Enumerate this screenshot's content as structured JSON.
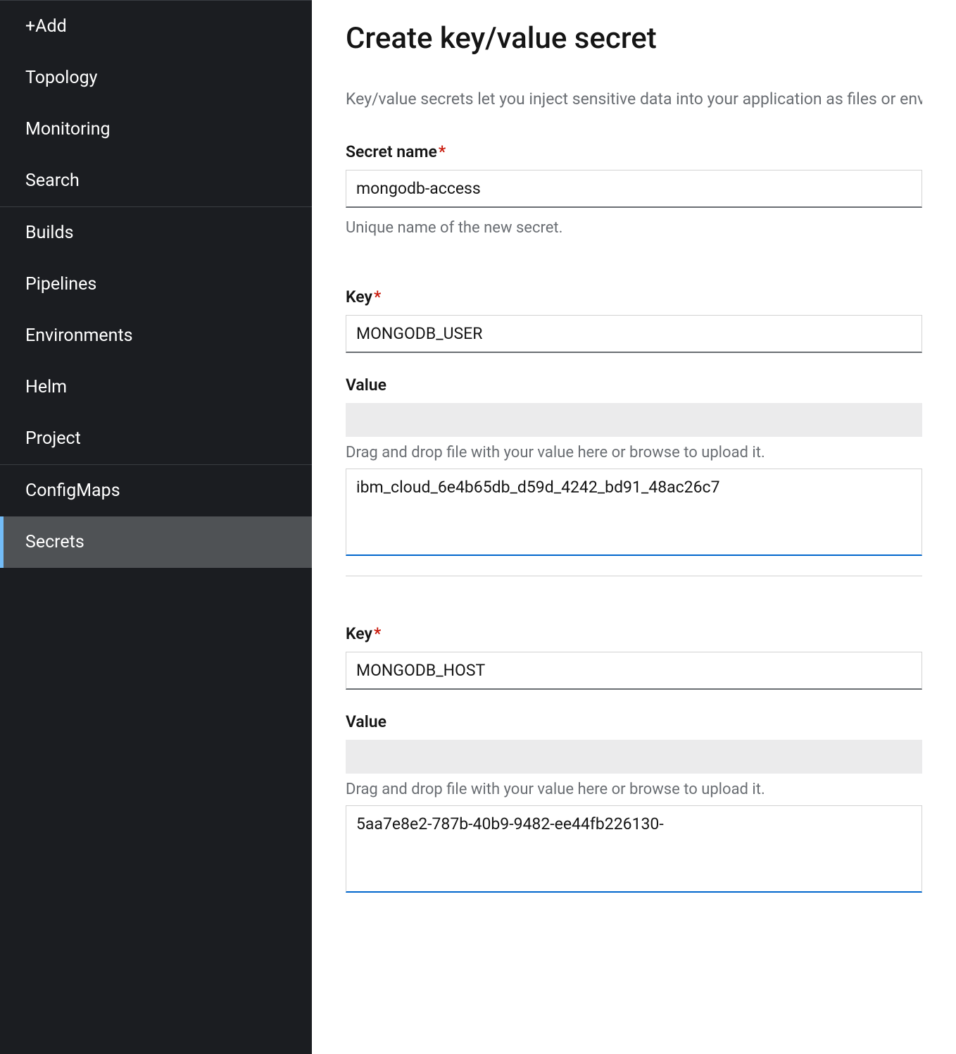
{
  "sidebar": {
    "groups": [
      {
        "items": [
          {
            "label": "+Add",
            "name": "sidebar-item-add",
            "active": false
          },
          {
            "label": "Topology",
            "name": "sidebar-item-topology",
            "active": false
          },
          {
            "label": "Monitoring",
            "name": "sidebar-item-monitoring",
            "active": false
          },
          {
            "label": "Search",
            "name": "sidebar-item-search",
            "active": false
          }
        ]
      },
      {
        "items": [
          {
            "label": "Builds",
            "name": "sidebar-item-builds",
            "active": false
          },
          {
            "label": "Pipelines",
            "name": "sidebar-item-pipelines",
            "active": false
          },
          {
            "label": "Environments",
            "name": "sidebar-item-environments",
            "active": false
          },
          {
            "label": "Helm",
            "name": "sidebar-item-helm",
            "active": false
          },
          {
            "label": "Project",
            "name": "sidebar-item-project",
            "active": false
          }
        ]
      },
      {
        "items": [
          {
            "label": "ConfigMaps",
            "name": "sidebar-item-configmaps",
            "active": false
          },
          {
            "label": "Secrets",
            "name": "sidebar-item-secrets",
            "active": true
          }
        ]
      }
    ]
  },
  "page": {
    "title": "Create key/value secret",
    "description": "Key/value secrets let you inject sensitive data into your application as files or environment variables."
  },
  "form": {
    "secret_name": {
      "label": "Secret name",
      "required": true,
      "value": "mongodb-access",
      "help": "Unique name of the new secret."
    },
    "kv_pairs": [
      {
        "key_label": "Key",
        "key_required": true,
        "key_value": "MONGODB_USER",
        "value_label": "Value",
        "drag_text": "Drag and drop file with your value here or browse to upload it.",
        "value_value": "ibm_cloud_6e4b65db_d59d_4242_bd91_48ac26c7"
      },
      {
        "key_label": "Key",
        "key_required": true,
        "key_value": "MONGODB_HOST",
        "value_label": "Value",
        "drag_text": "Drag and drop file with your value here or browse to upload it.",
        "value_value": "5aa7e8e2-787b-40b9-9482-ee44fb226130-"
      }
    ]
  }
}
